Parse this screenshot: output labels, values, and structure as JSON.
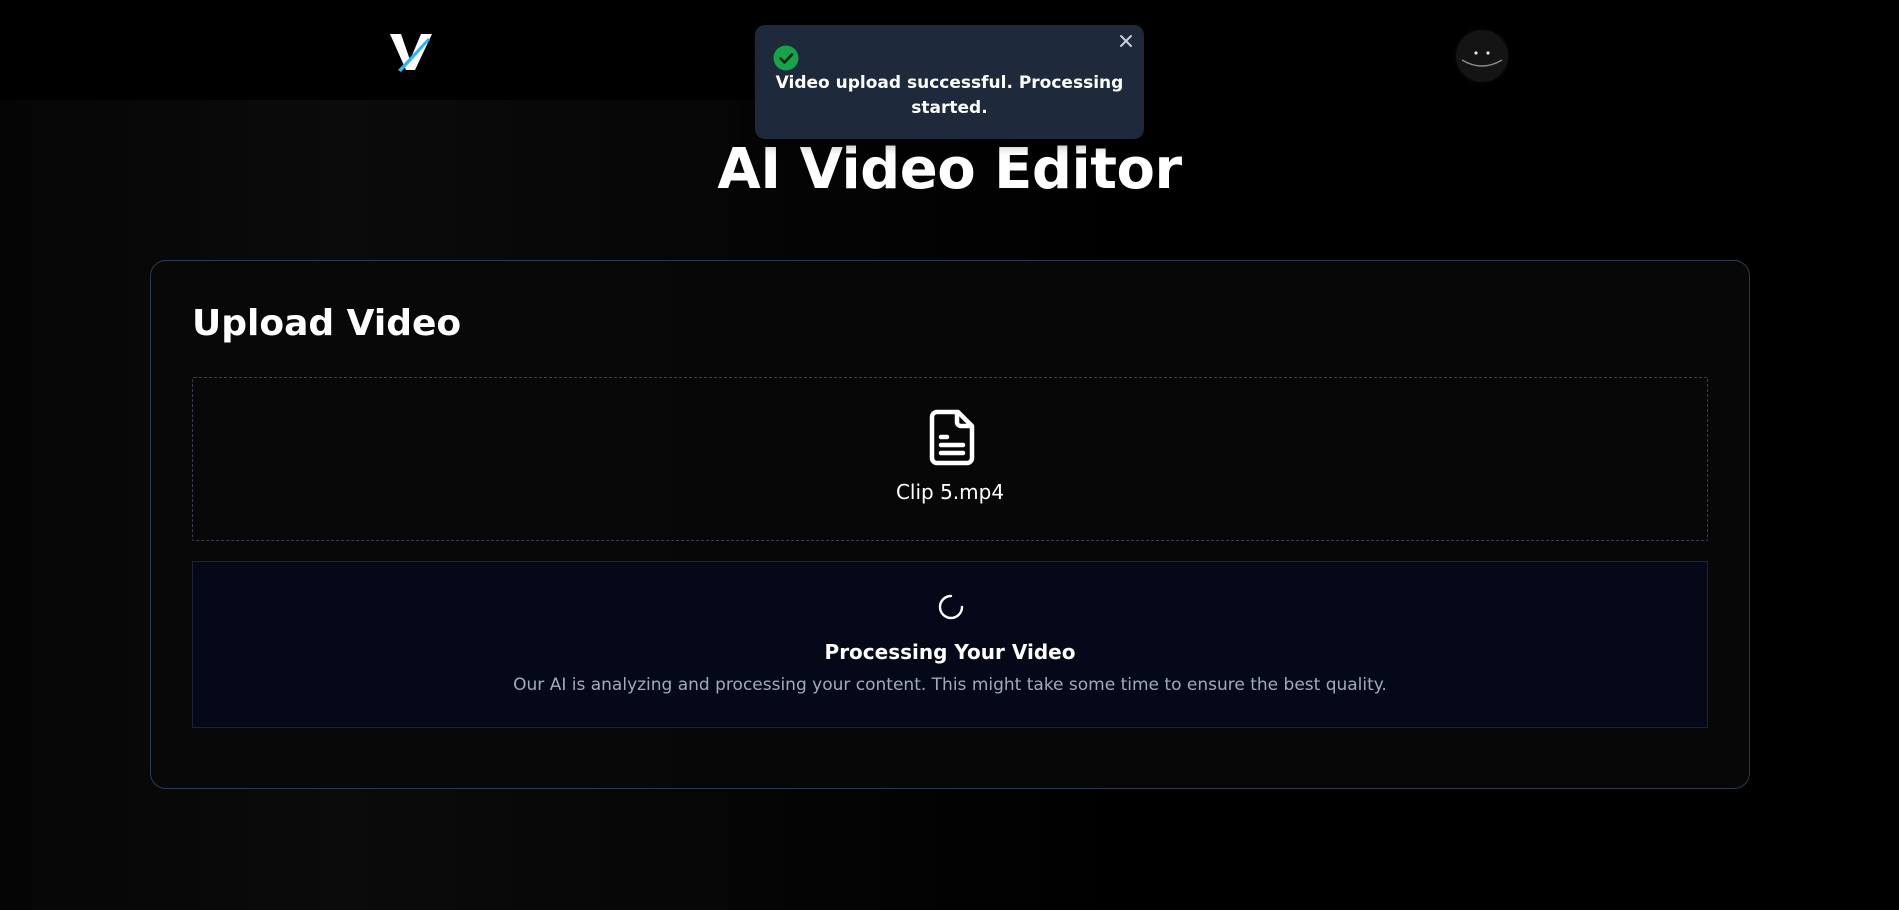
{
  "header": {
    "logo": {
      "icon": "v-logo-icon",
      "letter": "V",
      "colors": {
        "letter": "#ffffff",
        "slash": "#29b6f6"
      }
    },
    "avatar": {
      "icon": "smiley-avatar-icon"
    }
  },
  "toast": {
    "status_icon": "check-circle-icon",
    "status_color": "#16a34a",
    "message": "Video upload successful. Processing started.",
    "close_icon": "close-icon",
    "background": "#1e293b"
  },
  "page": {
    "title": "AI Video Editor"
  },
  "upload": {
    "heading": "Upload Video",
    "file_icon": "file-text-icon",
    "file_name": "Clip 5.mp4"
  },
  "processing": {
    "spinner_icon": "spinner-icon",
    "title": "Processing Your Video",
    "description": "Our AI is analyzing and processing your content. This might take some time to ensure the best quality."
  }
}
